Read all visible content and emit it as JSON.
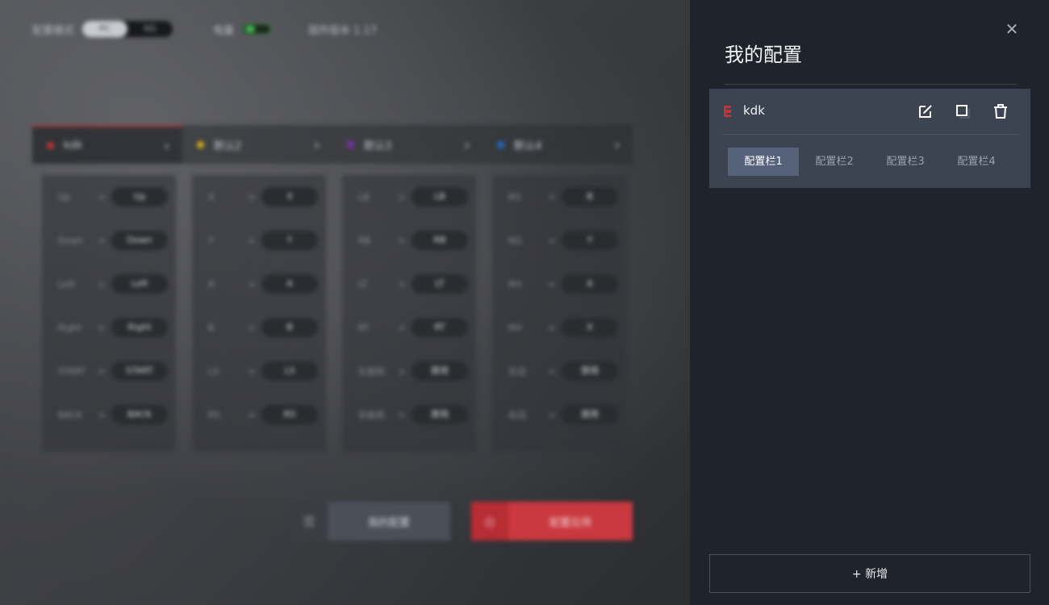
{
  "colors": {
    "panel_bg": "#1f232b",
    "card_bg": "#3d4451",
    "tab_active_bg": "#56627a",
    "accent_red": "#c9393f",
    "toggle_green": "#45c152"
  },
  "background": {
    "topbar": {
      "mode_label": "配置模式",
      "mode_options": [
        "PC",
        "NS"
      ],
      "vibration_label": "电量",
      "firmware_label": "固件版本 1.17"
    },
    "columns": [
      {
        "name": "kdk",
        "dot_color": "#c0353b",
        "rows": [
          [
            "Up",
            "Up"
          ],
          [
            "Down",
            "Down"
          ],
          [
            "Left",
            "Left"
          ],
          [
            "Right",
            "Right"
          ],
          [
            "START",
            "START"
          ],
          [
            "BACK",
            "BACK"
          ]
        ]
      },
      {
        "name": "默认2",
        "dot_color": "#d4b017",
        "rows": [
          [
            "X",
            "X"
          ],
          [
            "Y",
            "Y"
          ],
          [
            "A",
            "A"
          ],
          [
            "B",
            "B"
          ],
          [
            "LS",
            "LS"
          ],
          [
            "RS",
            "RS"
          ]
        ]
      },
      {
        "name": "默认3",
        "dot_color": "#7b2fb0",
        "rows": [
          [
            "LB",
            "LB"
          ],
          [
            "RB",
            "RB"
          ],
          [
            "LT",
            "LT"
          ],
          [
            "RT",
            "RT"
          ],
          [
            "左扳机",
            "禁用"
          ],
          [
            "右扳机",
            "禁用"
          ]
        ]
      },
      {
        "name": "默认4",
        "dot_color": "#1f6fc4",
        "rows": [
          [
            "M1",
            "B"
          ],
          [
            "M2",
            "Y"
          ],
          [
            "M3",
            "A"
          ],
          [
            "M4",
            "X"
          ],
          [
            "左边",
            "禁用"
          ],
          [
            "右边",
            "禁用"
          ]
        ]
      }
    ],
    "buttons": {
      "my_config": "我的配置",
      "apply_config": "配置应用"
    }
  },
  "panel": {
    "title": "我的配置",
    "close_icon": "close-icon",
    "config_item": {
      "icon": "controller-icon",
      "name": "kdk",
      "actions": [
        "edit-icon",
        "copy-icon",
        "delete-icon"
      ],
      "tabs": [
        "配置栏1",
        "配置栏2",
        "配置栏3",
        "配置栏4"
      ],
      "active_tab": 0
    },
    "add_button": "+ 新增"
  }
}
